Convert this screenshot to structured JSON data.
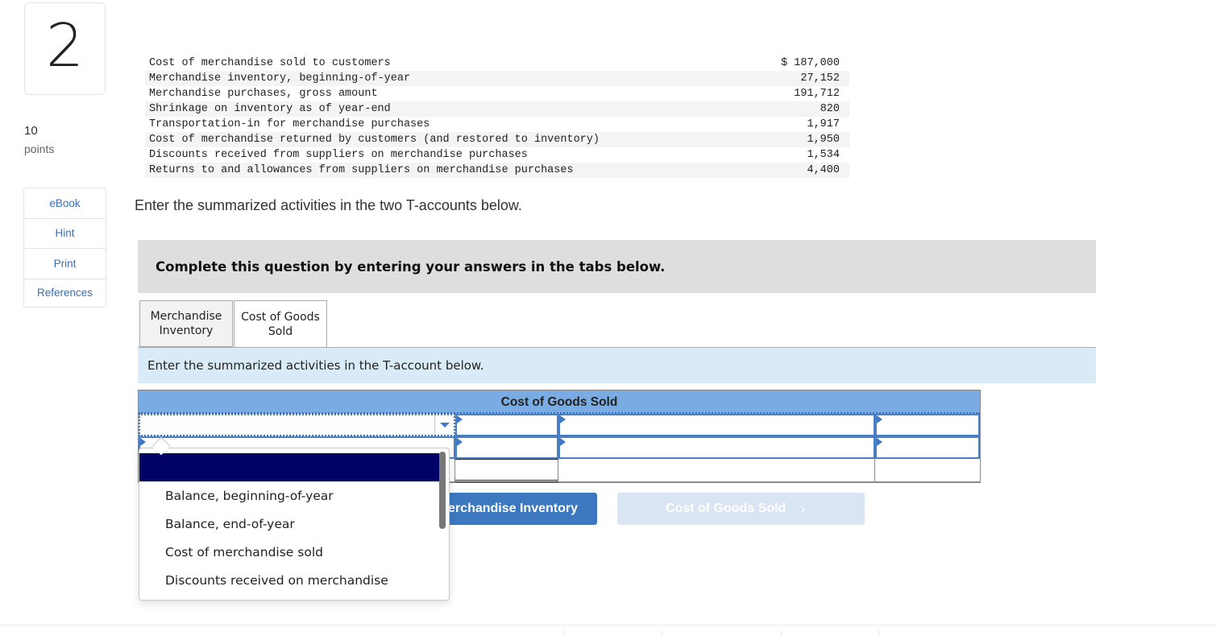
{
  "question": {
    "number": "2",
    "points_value": "10",
    "points_label": "points"
  },
  "sidebar": {
    "items": [
      {
        "label": "eBook"
      },
      {
        "label": "Hint"
      },
      {
        "label": "Print"
      },
      {
        "label": "References"
      }
    ]
  },
  "given_data": {
    "rows": [
      {
        "label": "Cost of merchandise sold to customers",
        "value": "$ 187,000"
      },
      {
        "label": "Merchandise inventory, beginning-of-year",
        "value": "27,152"
      },
      {
        "label": "Merchandise purchases, gross amount",
        "value": "191,712"
      },
      {
        "label": "Shrinkage on inventory as of year-end",
        "value": "820"
      },
      {
        "label": "Transportation-in for merchandise purchases",
        "value": "1,917"
      },
      {
        "label": "Cost of merchandise returned by customers (and restored to inventory)",
        "value": "1,950"
      },
      {
        "label": "Discounts received from suppliers on merchandise purchases",
        "value": "1,534"
      },
      {
        "label": "Returns to and allowances from suppliers on merchandise purchases",
        "value": "4,400"
      }
    ]
  },
  "instruction": "Enter the summarized activities in the two T-accounts below.",
  "banner": "Complete this question by entering your answers in the tabs below.",
  "tabs": [
    {
      "label": "Merchandise Inventory",
      "active": false
    },
    {
      "label": "Cost of Goods Sold",
      "active": true
    }
  ],
  "tab_panel": {
    "instruction": "Enter the summarized activities in the T-account below."
  },
  "taccount": {
    "title": "Cost of Goods Sold",
    "rows": [
      {
        "left_desc": "",
        "left_amount": "",
        "right_desc": "",
        "right_amount": ""
      },
      {
        "left_desc": "",
        "left_amount": "",
        "right_desc": "",
        "right_amount": ""
      },
      {
        "left_desc": "",
        "left_amount": "",
        "right_desc": "",
        "right_amount": ""
      }
    ]
  },
  "dropdown": {
    "selected": "",
    "options": [
      "",
      "Balance, beginning-of-year",
      "Balance, end-of-year",
      "Cost of merchandise sold",
      "Discounts received on merchandise"
    ]
  },
  "nav": {
    "prev_label": "Merchandise Inventory",
    "next_label": "Cost of Goods Sold",
    "next_chevron": "›"
  }
}
